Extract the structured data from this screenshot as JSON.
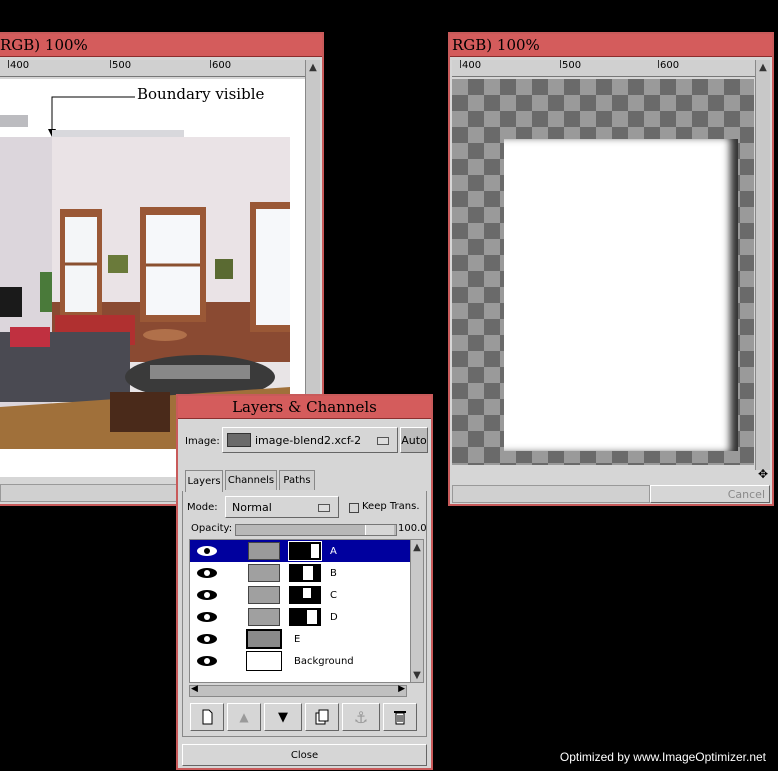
{
  "left_window": {
    "title": "RGB) 100%",
    "ruler_labels": [
      "400",
      "500",
      "600"
    ],
    "annotation": "Boundary visible"
  },
  "right_window": {
    "title": "RGB) 100%",
    "ruler_labels": [
      "400",
      "500",
      "600"
    ],
    "cancel_label": "Cancel"
  },
  "dialog": {
    "title": "Layers & Channels",
    "image_label": "Image:",
    "image_value": "image-blend2.xcf-2",
    "auto_label": "Auto",
    "tabs": [
      "Layers",
      "Channels",
      "Paths"
    ],
    "mode_label": "Mode:",
    "mode_value": "Normal",
    "keep_trans_label": "Keep Trans.",
    "opacity_label": "Opacity:",
    "opacity_value": "100.0",
    "layers": [
      {
        "name": "A",
        "selected": true
      },
      {
        "name": "B",
        "selected": false
      },
      {
        "name": "C",
        "selected": false
      },
      {
        "name": "D",
        "selected": false
      },
      {
        "name": "E",
        "selected": false
      },
      {
        "name": "Background",
        "selected": false
      }
    ],
    "close_label": "Close"
  },
  "footer": "Optimized by www.ImageOptimizer.net"
}
